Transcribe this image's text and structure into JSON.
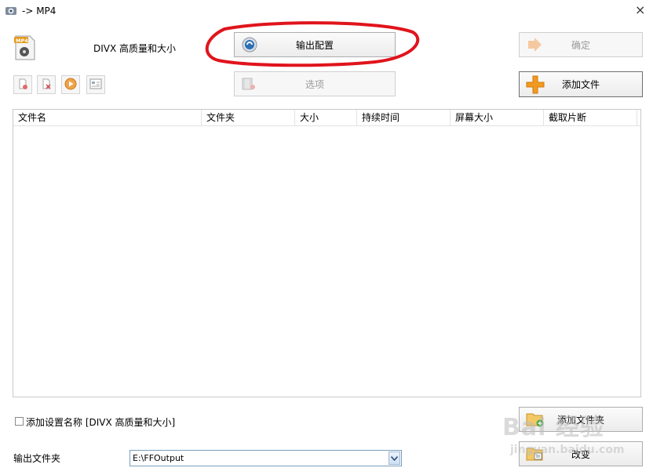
{
  "window": {
    "title": "-> MP4",
    "close_glyph": "×"
  },
  "profile": {
    "name": "DIVX 高质量和大小"
  },
  "buttons": {
    "output_config": "输出配置",
    "options": "选项",
    "ok": "确定",
    "add_file": "添加文件",
    "add_folder": "添加文件夹",
    "change": "改变"
  },
  "file_list": {
    "columns": [
      "文件名",
      "文件夹",
      "大小",
      "持续时间",
      "屏幕大小",
      "截取片断"
    ]
  },
  "footer": {
    "add_setting_label": "添加设置名称 [DIVX 高质量和大小]",
    "output_folder_label": "输出文件夹",
    "output_folder_value": "E:\\FFOutput"
  },
  "icons": [
    "app-icon",
    "mp4-file-icon",
    "remove-file-icon",
    "clear-list-icon",
    "play-icon",
    "media-info-icon",
    "output-config-icon",
    "options-icon",
    "ok-arrow-icon",
    "add-plus-icon",
    "folder-add-icon",
    "folder-change-icon",
    "dropdown-arrow-icon",
    "close-icon"
  ],
  "annotation": {
    "color": "#e0141c"
  },
  "watermark": {
    "line1": "Bai 经验",
    "line2": "jingyan.baidu.com"
  }
}
